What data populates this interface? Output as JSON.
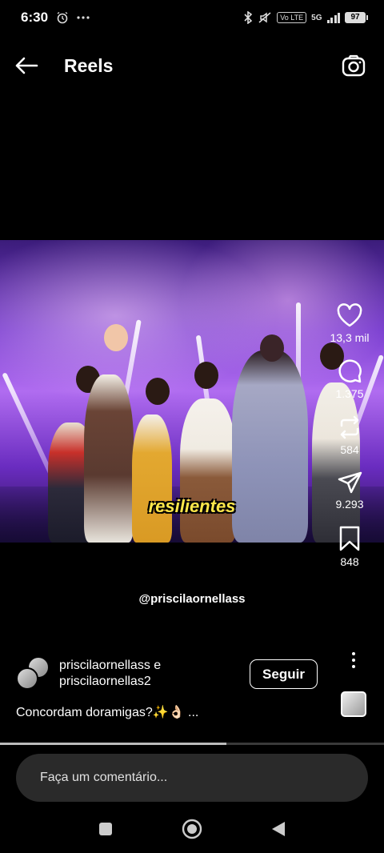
{
  "status_bar": {
    "time": "6:30",
    "network_label": "5G",
    "volte_label": "Vo LTE",
    "battery": "97"
  },
  "header": {
    "title": "Reels"
  },
  "video": {
    "caption_overlay": "resilientes",
    "watermark": "@priscilaornellass"
  },
  "actions": {
    "likes": "13,3 mil",
    "comments": "1.375",
    "reposts": "584",
    "shares": "9.293",
    "saves": "848"
  },
  "author": {
    "line1": "priscilaornellass e",
    "line2": "priscilaornellas2",
    "follow_label": "Seguir"
  },
  "caption": "Concordam doramigas?✨👌🏻 ...",
  "progress": 0.59,
  "comment": {
    "placeholder": "Faça um comentário..."
  },
  "colors": {
    "background": "#000000",
    "overlay_text": "#ffe84a",
    "video_tint": "#7a3fd0"
  },
  "icons": [
    "back-arrow-icon",
    "camera-icon",
    "heart-icon",
    "comment-icon",
    "repost-icon",
    "share-icon",
    "bookmark-icon",
    "more-vertical-icon",
    "nav-recents-icon",
    "nav-home-icon",
    "nav-back-icon"
  ]
}
